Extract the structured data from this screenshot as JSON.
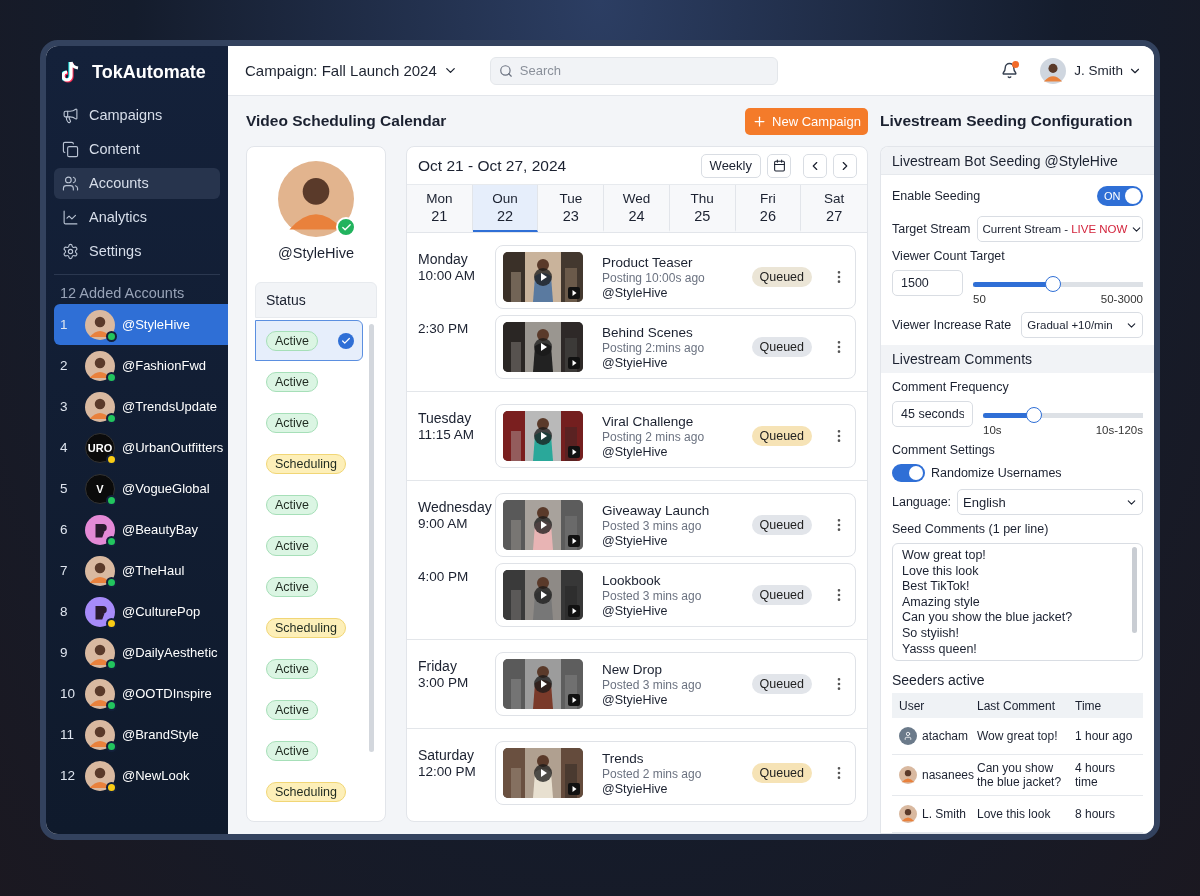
{
  "app": {
    "name": "TokAutomate"
  },
  "nav": [
    {
      "label": "Campaigns",
      "kind": "megaphone",
      "selected": false
    },
    {
      "label": "Content",
      "kind": "copy",
      "selected": false
    },
    {
      "label": "Accounts",
      "kind": "users",
      "selected": true
    },
    {
      "label": "Analytics",
      "kind": "chart",
      "selected": false
    },
    {
      "label": "Settings",
      "kind": "gear",
      "selected": false
    }
  ],
  "accounts_heading": "12 Added Accounts",
  "accounts": [
    {
      "number": "1",
      "handle": "@StyleHive",
      "color": "#22c55e",
      "selected": true,
      "status": {
        "kind": "active",
        "label": "Active"
      }
    },
    {
      "number": "2",
      "handle": "@FashionFwd",
      "color": "#22c55e",
      "selected": false,
      "status": {
        "kind": "active",
        "label": "Active"
      }
    },
    {
      "number": "3",
      "handle": "@TrendsUpdate",
      "color": "#22c55e",
      "selected": false,
      "status": {
        "kind": "active",
        "label": "Active"
      }
    },
    {
      "number": "4",
      "handle": "@UrbanOutfitters",
      "avatar": {
        "kind": "monogram",
        "text": "URO"
      },
      "color": "#facc15",
      "selected": false,
      "status": {
        "kind": "scheduling",
        "label": "Scheduling"
      }
    },
    {
      "number": "5",
      "handle": "@VogueGlobal",
      "avatar": {
        "kind": "monogram",
        "text": "V"
      },
      "color": "#22c55e",
      "selected": false,
      "status": {
        "kind": "active",
        "label": "Active"
      }
    },
    {
      "number": "6",
      "handle": "@BeautyBay",
      "avatar": {
        "kind": "logo",
        "color": "#e48ad6"
      },
      "color": "#22c55e",
      "selected": false,
      "status": {
        "kind": "active",
        "label": "Active"
      }
    },
    {
      "number": "7",
      "handle": "@TheHaul",
      "color": "#22c55e",
      "selected": false,
      "status": {
        "kind": "active",
        "label": "Active"
      }
    },
    {
      "number": "8",
      "handle": "@CulturePop",
      "avatar": {
        "kind": "logo",
        "color": "#a78bfa"
      },
      "color": "#facc15",
      "selected": false,
      "status": {
        "kind": "scheduling",
        "label": "Scheduling"
      }
    },
    {
      "number": "9",
      "handle": "@DailyAesthetic",
      "color": "#22c55e",
      "selected": false,
      "status": {
        "kind": "active",
        "label": "Active"
      }
    },
    {
      "number": "10",
      "handle": "@OOTDInspire",
      "color": "#22c55e",
      "selected": false,
      "status": {
        "kind": "active",
        "label": "Active"
      }
    },
    {
      "number": "11",
      "handle": "@BrandStyle",
      "color": "#22c55e",
      "selected": false,
      "status": {
        "kind": "active",
        "label": "Active"
      }
    },
    {
      "number": "12",
      "handle": "@NewLook",
      "color": "#facc15",
      "selected": false,
      "status": {
        "kind": "scheduling",
        "label": "Scheduling"
      }
    }
  ],
  "topbar": {
    "campaign": "Campaign: Fall Launch 2024",
    "search_placeholder": "Search",
    "unread_notifications": true,
    "user": "J. Smith"
  },
  "calendar_title": "Video Scheduling Calendar",
  "new_campaign_button": "New Campaign",
  "profile": {
    "handle": "@StyleHive",
    "verified": true,
    "status_heading": "Status"
  },
  "calendar": {
    "range": "Oct 21 - Oct 27, 2024",
    "view": "Weekly",
    "days": [
      {
        "name": "Mon",
        "date": "21",
        "selected": false
      },
      {
        "name": "Oun",
        "date": "22",
        "selected": true
      },
      {
        "name": "Tue",
        "date": "23",
        "selected": false
      },
      {
        "name": "Wed",
        "date": "24",
        "selected": false
      },
      {
        "name": "Thu",
        "date": "25",
        "selected": false
      },
      {
        "name": "Fri",
        "date": "26",
        "selected": false
      },
      {
        "name": "Sat",
        "date": "27",
        "selected": false
      }
    ],
    "groups": [
      {
        "day": "Monday",
        "slots": [
          {
            "time": "10:00 AM",
            "title": "Product Teaser",
            "meta": "Posting 10:00s ago",
            "handle": "@StyleHive",
            "badge": "Queued",
            "color": "#ebe5d6"
          },
          {
            "time": "2:30 PM",
            "title": "Behind Scenes",
            "meta": "Posting 2:mins ago",
            "handle": "@StyieHive",
            "badge": "Queued",
            "color": "#e2e5ea"
          }
        ]
      },
      {
        "day": "Tuesday",
        "slots": [
          {
            "time": "11:15 AM",
            "title": "Viral Challenge",
            "meta": "Posting 2 mins ago",
            "handle": "@StyleHive",
            "badge": "Queued",
            "color": "#f6e3b6"
          }
        ]
      },
      {
        "day": "Wednesday",
        "slots": [
          {
            "time": "9:00 AM",
            "title": "Giveaway Launch",
            "meta": "Posted 3 mins ago",
            "handle": "@StyieHive",
            "badge": "Queued",
            "color": "#e2e5ea"
          },
          {
            "time": "4:00 PM",
            "title": "Lookbook",
            "meta": "Posted 3 mins ago",
            "handle": "@StyieHive",
            "badge": "Queued",
            "color": "#e2e5ea"
          }
        ]
      },
      {
        "day": "Friday",
        "slots": [
          {
            "time": "3:00 PM",
            "title": "New Drop",
            "meta": "Posted 3 mins ago",
            "handle": "@StyieHive",
            "badge": "Queued",
            "color": "#e2e5ea"
          }
        ]
      },
      {
        "day": "Saturday",
        "slots": [
          {
            "time": "12:00 PM",
            "title": "Trends",
            "meta": "Posted 2 mins ago",
            "handle": "@StyieHive",
            "badge": "Queued",
            "color": "#f6e3b6"
          }
        ]
      }
    ]
  },
  "config": {
    "title": "Livestream Seeding Configuration",
    "card_title": "Livestream Bot Seeding @StyleHive",
    "enable": {
      "label": "Enable Seeding",
      "on": true,
      "on_label": "ON"
    },
    "target": {
      "label": "Target Stream",
      "value": "Current Stream -",
      "live": "LIVE NOW"
    },
    "viewers": {
      "label": "Viewer Count Target",
      "value": "1500",
      "level": 0.47,
      "min": "50",
      "range": "50-3000"
    },
    "rate": {
      "label": "Viewer Increase Rate",
      "value": "Gradual +10/min"
    },
    "comments_heading": "Livestream Comments",
    "frequency": {
      "label": "Comment Frequency",
      "value": "45 seconds",
      "level": 0.32,
      "min": "10s",
      "range": "10s-120s"
    },
    "settings_label": "Comment Settings",
    "randomize": {
      "label": "Randomize Usernames",
      "on": true
    },
    "language": {
      "label": "Language:",
      "value": "English"
    },
    "seed": {
      "label": "Seed Comments (1 per line)",
      "lines": [
        "Wow great top!",
        "Love this look",
        "Best TikTok!",
        "Amazing style",
        "Can you show the blue jacket?",
        "So styiish!",
        "Yasss queen!"
      ]
    },
    "seeders": {
      "title": "Seeders active",
      "columns": [
        "User",
        "Last Comment",
        "Time"
      ],
      "rows": [
        {
          "user": "atacham",
          "avatar": {
            "kind": "placeholder"
          },
          "comment": "Wow great top!",
          "time": "1 hour ago"
        },
        {
          "user": "nasanees",
          "comment": "Can you show the blue jacket?",
          "time": "4 hours time"
        },
        {
          "user": "L. Smith",
          "comment": "Love this look",
          "time": "8 hours"
        }
      ]
    }
  }
}
